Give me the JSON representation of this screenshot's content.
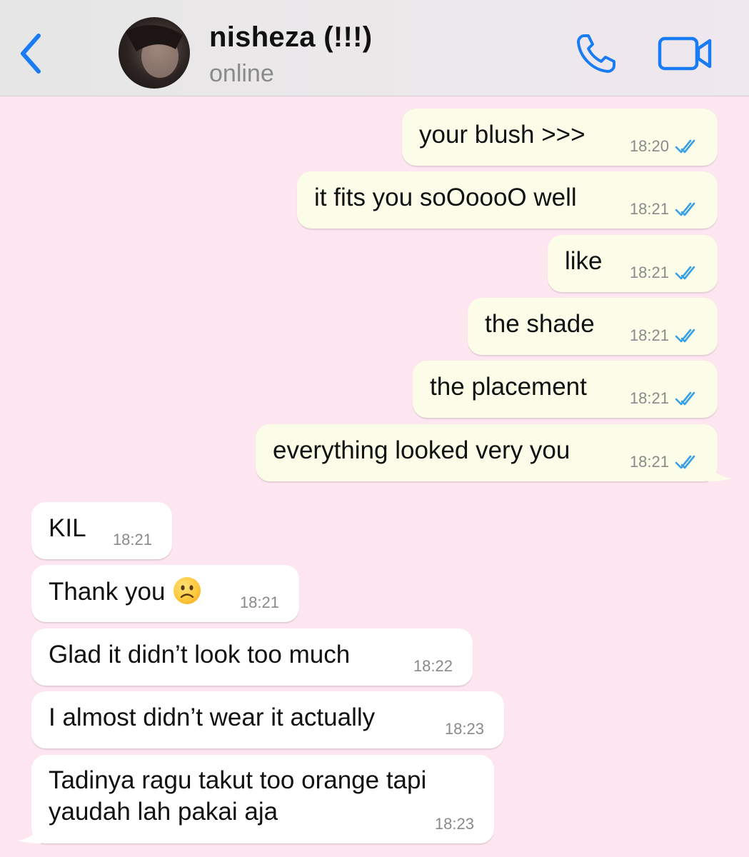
{
  "header": {
    "contact_name": "nisheza (!!!)",
    "contact_status": "online",
    "back_icon": "chevron-left-icon",
    "call_icon": "phone-icon",
    "video_icon": "video-camera-icon",
    "accent_color": "#1a7cf5"
  },
  "messages": [
    {
      "direction": "outgoing",
      "text": "your blush >>>",
      "time": "18:20",
      "status": "read"
    },
    {
      "direction": "outgoing",
      "text": "it fits you soOoooO well",
      "time": "18:21",
      "status": "read"
    },
    {
      "direction": "outgoing",
      "text": "like",
      "time": "18:21",
      "status": "read"
    },
    {
      "direction": "outgoing",
      "text": "the shade",
      "time": "18:21",
      "status": "read"
    },
    {
      "direction": "outgoing",
      "text": "the placement",
      "time": "18:21",
      "status": "read"
    },
    {
      "direction": "outgoing",
      "text": "everything looked very you",
      "time": "18:21",
      "status": "read"
    },
    {
      "direction": "incoming",
      "text": "KIL",
      "time": "18:21"
    },
    {
      "direction": "incoming",
      "text": "Thank you",
      "emoji": "frowning-face-emoji",
      "time": "18:21"
    },
    {
      "direction": "incoming",
      "text": "Glad it didn’t look too much",
      "time": "18:22"
    },
    {
      "direction": "incoming",
      "text": "I almost didn’t wear it actually",
      "time": "18:23"
    },
    {
      "direction": "incoming",
      "text_lines": [
        "Tadinya ragu takut too orange tapi",
        "yaudah lah pakai aja"
      ],
      "time": "18:23"
    }
  ],
  "colors": {
    "chat_background": "#fde6f0",
    "outgoing_bubble": "#fcfde8",
    "incoming_bubble": "#ffffff",
    "read_ticks": "#3aa0e6"
  }
}
